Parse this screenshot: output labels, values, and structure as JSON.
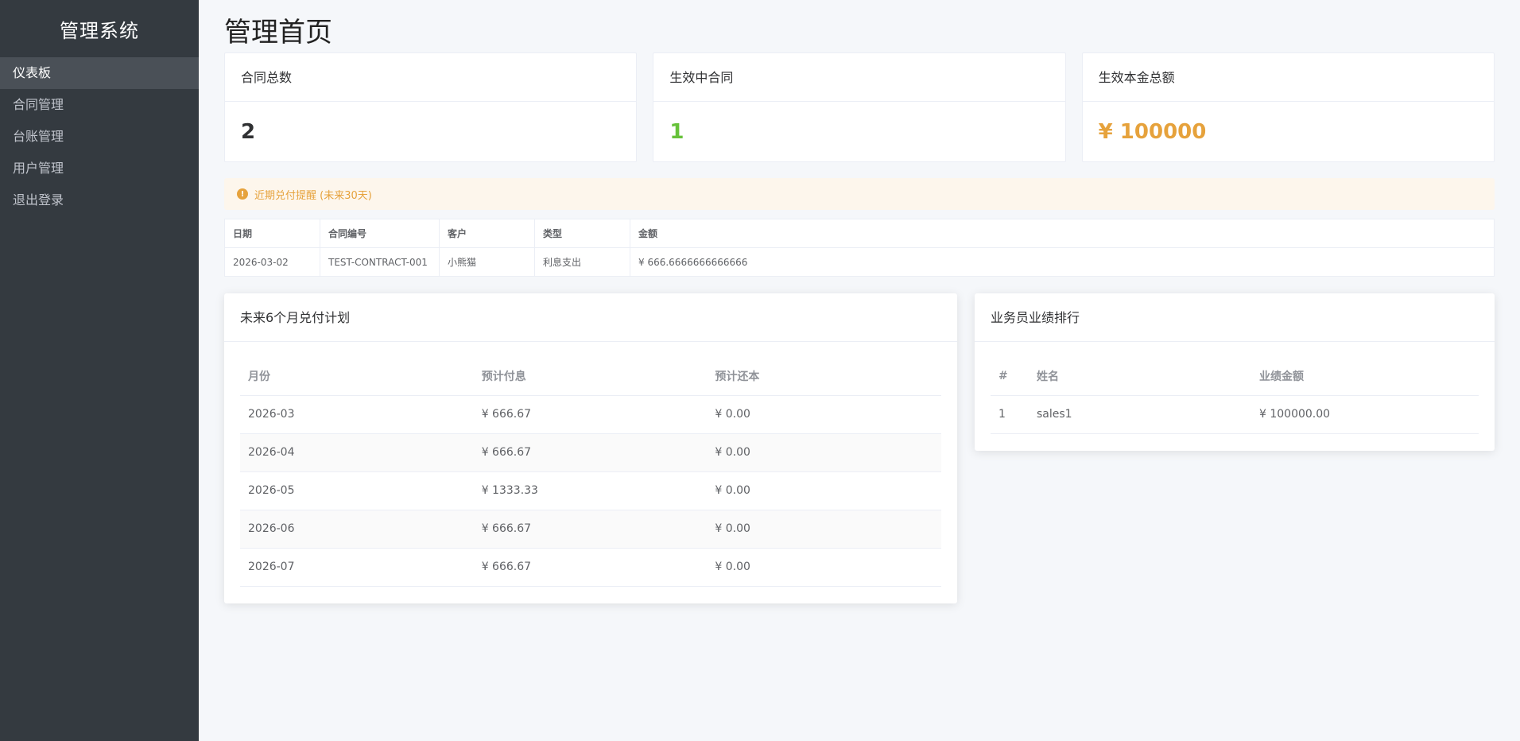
{
  "sidebar": {
    "title": "管理系统",
    "items": [
      {
        "label": "仪表板"
      },
      {
        "label": "合同管理"
      },
      {
        "label": "台账管理"
      },
      {
        "label": "用户管理"
      },
      {
        "label": "退出登录"
      }
    ]
  },
  "page": {
    "title": "管理首页"
  },
  "stats": [
    {
      "label": "合同总数",
      "value": "2",
      "color": "#303133"
    },
    {
      "label": "生效中合同",
      "value": "1",
      "color": "#67c23a"
    },
    {
      "label": "生效本金总额",
      "value": "¥ 100000",
      "color": "#e6a23c"
    }
  ],
  "alert": {
    "text": "近期兑付提醒 (未来30天)",
    "color": "#e6a23c"
  },
  "reminder_table": {
    "headers": [
      "日期",
      "合同编号",
      "客户",
      "类型",
      "金额"
    ],
    "rows": [
      [
        "2026-03-02",
        "TEST-CONTRACT-001",
        "小熊猫",
        "利息支出",
        "¥ 666.6666666666666"
      ]
    ]
  },
  "payment_plan": {
    "title": "未来6个月兑付计划",
    "headers": [
      "月份",
      "预计付息",
      "预计还本"
    ],
    "rows": [
      [
        "2026-03",
        "¥ 666.67",
        "¥ 0.00"
      ],
      [
        "2026-04",
        "¥ 666.67",
        "¥ 0.00"
      ],
      [
        "2026-05",
        "¥ 1333.33",
        "¥ 0.00"
      ],
      [
        "2026-06",
        "¥ 666.67",
        "¥ 0.00"
      ],
      [
        "2026-07",
        "¥ 666.67",
        "¥ 0.00"
      ]
    ]
  },
  "ranking": {
    "title": "业务员业绩排行",
    "headers": [
      "#",
      "姓名",
      "业绩金额"
    ],
    "rows": [
      [
        "1",
        "sales1",
        "¥ 100000.00"
      ]
    ]
  }
}
